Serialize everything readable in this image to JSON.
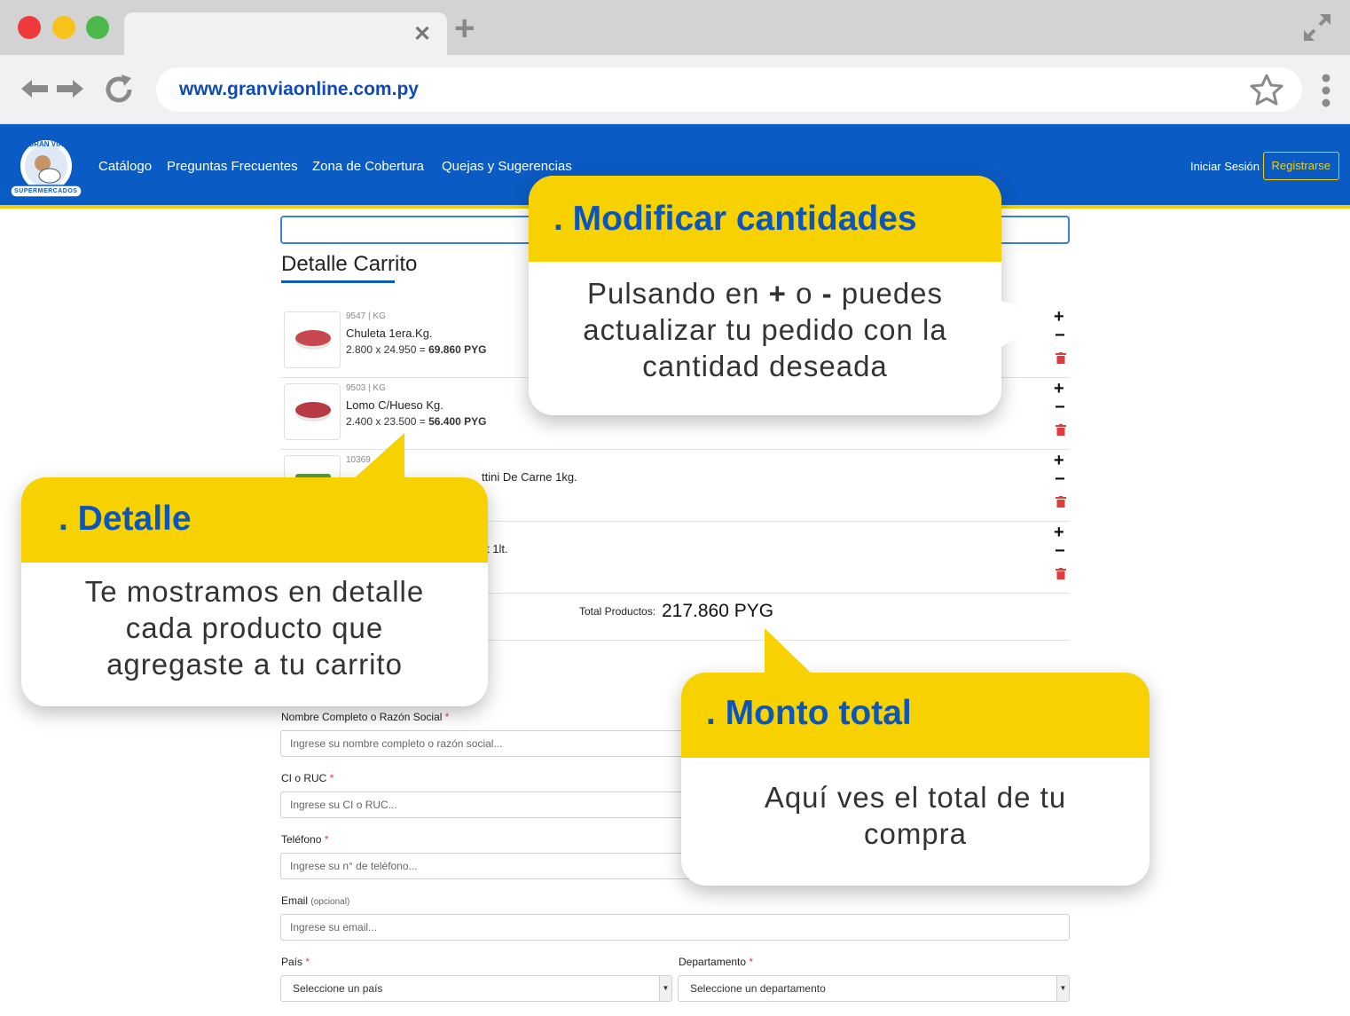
{
  "browser": {
    "url": "www.granviaonline.com.py",
    "tab_close": "✕",
    "new_tab": "+"
  },
  "navbar": {
    "logo_text_top": "GRAN VIA",
    "logo_text_bottom": "SUPERMERCADOS",
    "links": [
      "Catálogo",
      "Preguntas Frecuentes",
      "Zona de Cobertura",
      "Quejas y Sugerencias"
    ],
    "login": "Iniciar Sesión",
    "register": "Registrarse"
  },
  "cart": {
    "title": "Detalle Carrito",
    "items": [
      {
        "code": "9547 | KG",
        "name": "Chuleta 1era.Kg.",
        "qty_price": "2.800 x 24.950 =",
        "subtotal": "69.860 PYG"
      },
      {
        "code": "9503 | KG",
        "name": "Lomo C/Hueso Kg.",
        "qty_price": "2.400 x 23.500 =",
        "subtotal": "56.400 PYG"
      },
      {
        "code": "10369",
        "name": "ttini De Carne 1kg."
      },
      {
        "name": "t 1lt."
      }
    ],
    "plus": "+",
    "minus": "−",
    "total_label": "Total Productos:",
    "total_value": "217.860 PYG"
  },
  "form": {
    "name_label": "Nombre Completo o Razón Social",
    "name_placeholder": "Ingrese su nombre completo o razón social...",
    "ci_label": "CI o RUC",
    "ci_placeholder": "Ingrese su CI o RUC...",
    "phone_label": "Teléfono",
    "phone_placeholder": "Ingrese su n° de teléfono...",
    "email_label": "Email",
    "email_optional": "(opcional)",
    "email_placeholder": "Ingrese su email...",
    "country_label": "País",
    "country_value": "Seleccione un país",
    "department_label": "Departamento",
    "department_value": "Seleccione un departamento",
    "required_mark": "*"
  },
  "callouts": {
    "modify": {
      "title": ". Modificar cantidades",
      "body_line1_pre": "Pulsando en",
      "body_plus": "+",
      "body_o": "o",
      "body_minus": "-",
      "body_line1_post": "puedes",
      "body_line2": "actualizar tu pedido con la",
      "body_line3": "cantidad deseada"
    },
    "detail": {
      "title": ". Detalle",
      "body_line1": "Te mostramos en detalle",
      "body_line2": "cada producto que",
      "body_line3": "agregaste a tu carrito"
    },
    "total": {
      "title": ". Monto total",
      "body_line1": "Aquí ves el total de tu",
      "body_line2": "compra"
    }
  },
  "colors": {
    "brand_blue": "#0b5bc4",
    "brand_yellow": "#f8d100",
    "trash_red": "#e23b3b"
  }
}
